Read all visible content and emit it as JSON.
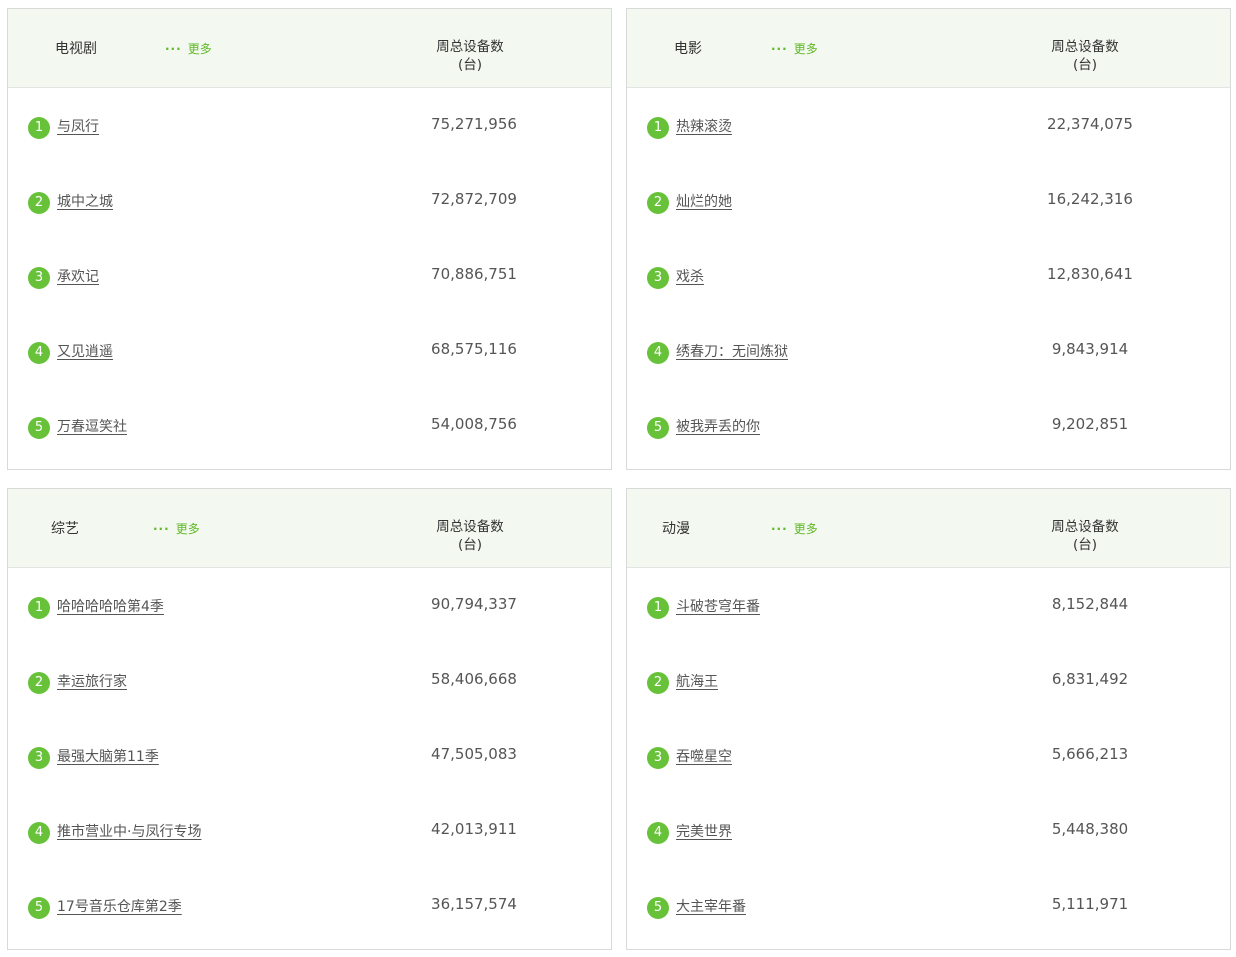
{
  "more_label": "更多",
  "column_header_line1": "周总设备数",
  "column_header_line2": "(台)",
  "accent_color": "#67c23a",
  "header_bg_color": "#f3f9f0",
  "panels": [
    {
      "category": "电视剧",
      "rows": [
        {
          "rank": "1",
          "title": "与凤行",
          "value": "75,271,956"
        },
        {
          "rank": "2",
          "title": "城中之城",
          "value": "72,872,709"
        },
        {
          "rank": "3",
          "title": "承欢记",
          "value": "70,886,751"
        },
        {
          "rank": "4",
          "title": "又见逍遥",
          "value": "68,575,116"
        },
        {
          "rank": "5",
          "title": "万春逗笑社",
          "value": "54,008,756"
        }
      ]
    },
    {
      "category": "电影",
      "rows": [
        {
          "rank": "1",
          "title": "热辣滚烫",
          "value": "22,374,075"
        },
        {
          "rank": "2",
          "title": "灿烂的她",
          "value": "16,242,316"
        },
        {
          "rank": "3",
          "title": "戏杀",
          "value": "12,830,641"
        },
        {
          "rank": "4",
          "title": "绣春刀：无间炼狱",
          "value": "9,843,914"
        },
        {
          "rank": "5",
          "title": "被我弄丢的你",
          "value": "9,202,851"
        }
      ]
    },
    {
      "category": "综艺",
      "rows": [
        {
          "rank": "1",
          "title": "哈哈哈哈哈第4季",
          "value": "90,794,337"
        },
        {
          "rank": "2",
          "title": "幸运旅行家",
          "value": "58,406,668"
        },
        {
          "rank": "3",
          "title": "最强大脑第11季",
          "value": "47,505,083"
        },
        {
          "rank": "4",
          "title": "推市营业中·与凤行专场",
          "value": "42,013,911"
        },
        {
          "rank": "5",
          "title": "17号音乐仓库第2季",
          "value": "36,157,574"
        }
      ]
    },
    {
      "category": "动漫",
      "rows": [
        {
          "rank": "1",
          "title": "斗破苍穹年番",
          "value": "8,152,844"
        },
        {
          "rank": "2",
          "title": "航海王",
          "value": "6,831,492"
        },
        {
          "rank": "3",
          "title": "吞噬星空",
          "value": "5,666,213"
        },
        {
          "rank": "4",
          "title": "完美世界",
          "value": "5,448,380"
        },
        {
          "rank": "5",
          "title": "大主宰年番",
          "value": "5,111,971"
        }
      ]
    }
  ]
}
